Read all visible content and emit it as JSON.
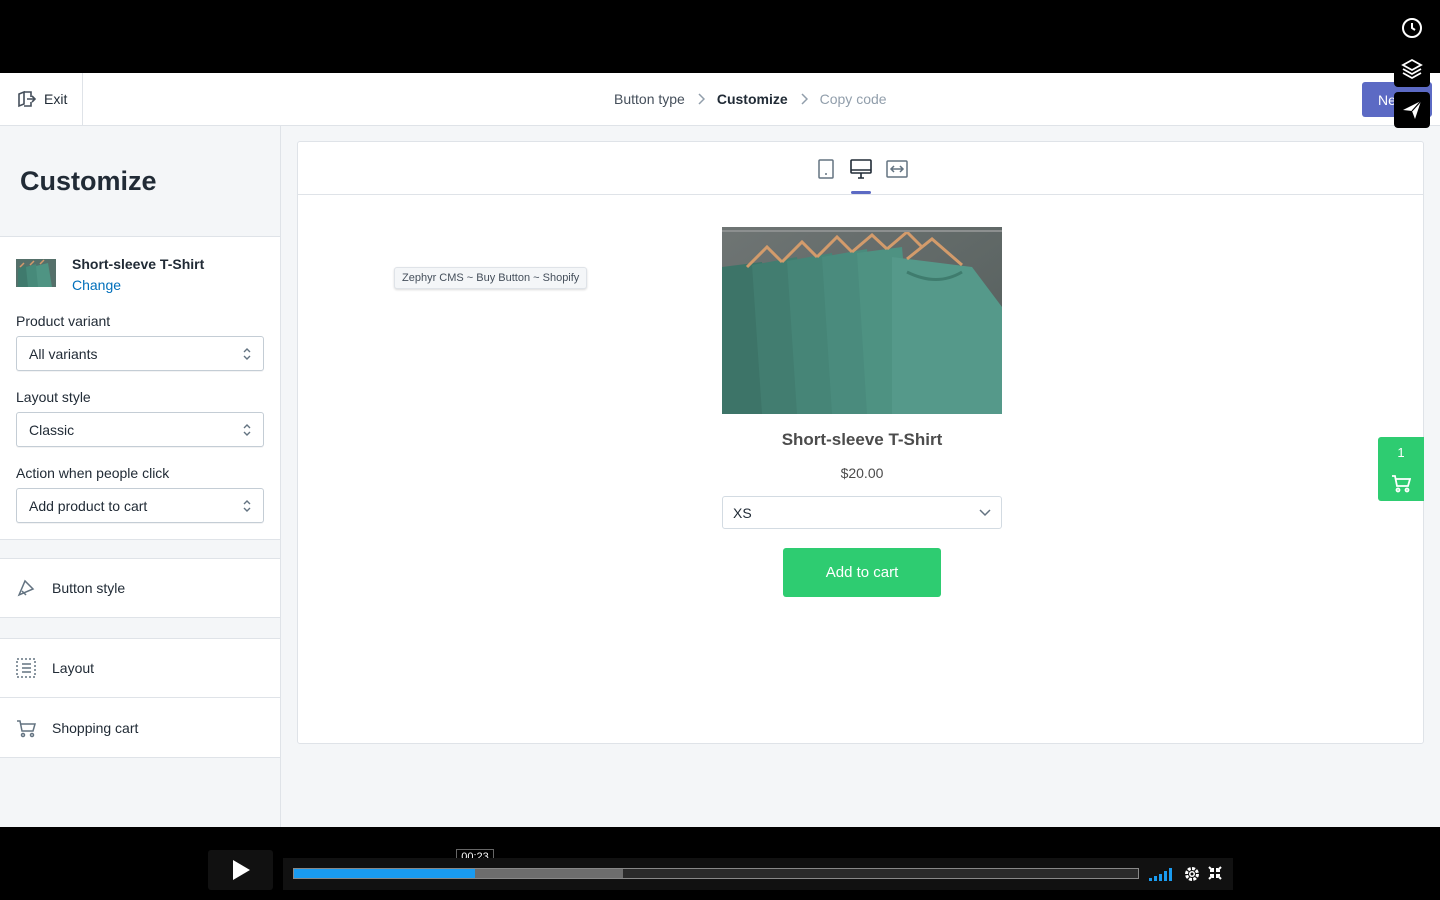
{
  "topbar": {
    "exit_label": "Exit",
    "breadcrumbs": [
      "Button type",
      "Customize",
      "Copy code"
    ],
    "next_label": "Next"
  },
  "sidebar": {
    "title": "Customize",
    "product": {
      "name": "Short-sleeve T-Shirt",
      "change_label": "Change"
    },
    "fields": {
      "variant": {
        "label": "Product variant",
        "value": "All variants"
      },
      "layout": {
        "label": "Layout style",
        "value": "Classic"
      },
      "action": {
        "label": "Action when people click",
        "value": "Add product to cart"
      }
    },
    "sections": [
      {
        "label": "Button style",
        "icon": "button-style-icon"
      },
      {
        "label": "Layout",
        "icon": "layout-icon"
      },
      {
        "label": "Shopping cart",
        "icon": "cart-icon"
      }
    ]
  },
  "preview": {
    "tooltip": "Zephyr CMS ~ Buy Button ~ Shopify",
    "product_title": "Short-sleeve T-Shirt",
    "price": "$20.00",
    "size_value": "XS",
    "add_to_cart_label": "Add to cart",
    "cart_count": "1",
    "accent_color": "#2ecc71"
  },
  "video": {
    "time": "00:23",
    "played_fraction": 0.215,
    "loaded_fraction": 0.39
  },
  "colors": {
    "primary": "#5c6ac4",
    "link": "#006fbb",
    "progress": "#1a9bf0"
  }
}
